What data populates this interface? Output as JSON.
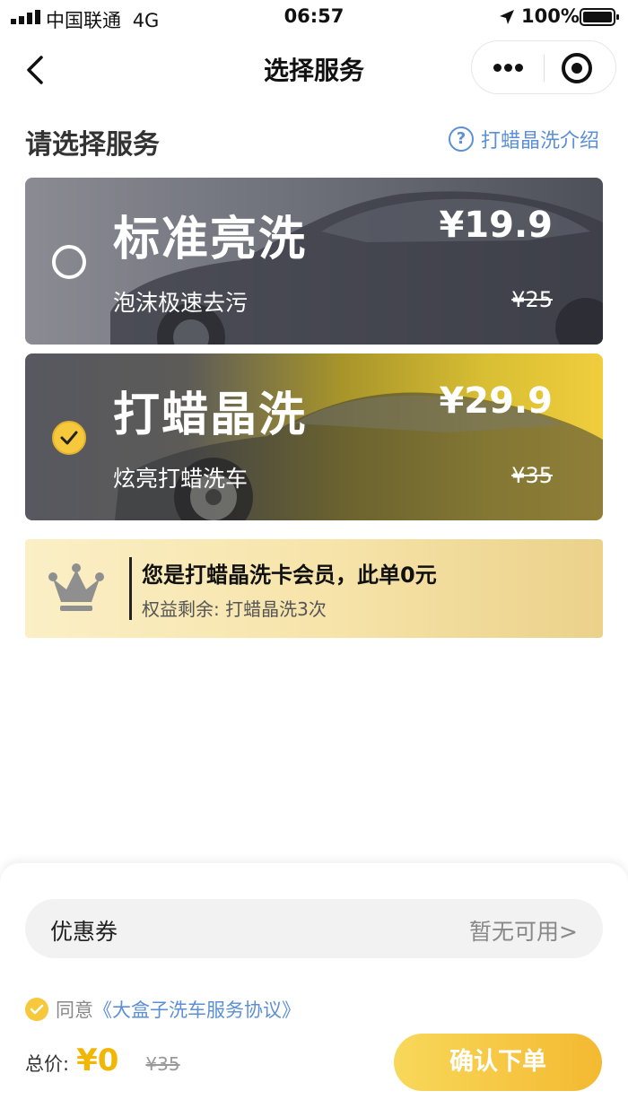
{
  "status_bar": {
    "carrier": "中国联通",
    "network": "4G",
    "time": "06:57",
    "battery": "100%"
  },
  "nav": {
    "title": "选择服务"
  },
  "section": {
    "title": "请选择服务",
    "intro_link": "打蜡晶洗介绍"
  },
  "services": [
    {
      "name": "标准亮洗",
      "desc": "泡沫极速去污",
      "price": "¥19.9",
      "original_price": "¥25",
      "selected": false
    },
    {
      "name": "打蜡晶洗",
      "desc": "炫亮打蜡洗车",
      "price": "¥29.9",
      "original_price": "¥35",
      "selected": true
    }
  ],
  "member": {
    "title": "您是打蜡晶洗卡会员，此单0元",
    "subtitle": "权益剩余: 打蜡晶洗3次"
  },
  "coupon": {
    "label": "优惠券",
    "value": "暂无可用>"
  },
  "agreement": {
    "prefix": "同意",
    "link": "《大盒子洗车服务协议》"
  },
  "footer": {
    "total_label": "总价:",
    "total_price": "¥0",
    "original_price": "¥35",
    "confirm_label": "确认下单"
  },
  "colors": {
    "accent_yellow": "#f4b931",
    "link_blue": "#5b8fd6",
    "price_yellow": "#f2b705"
  }
}
